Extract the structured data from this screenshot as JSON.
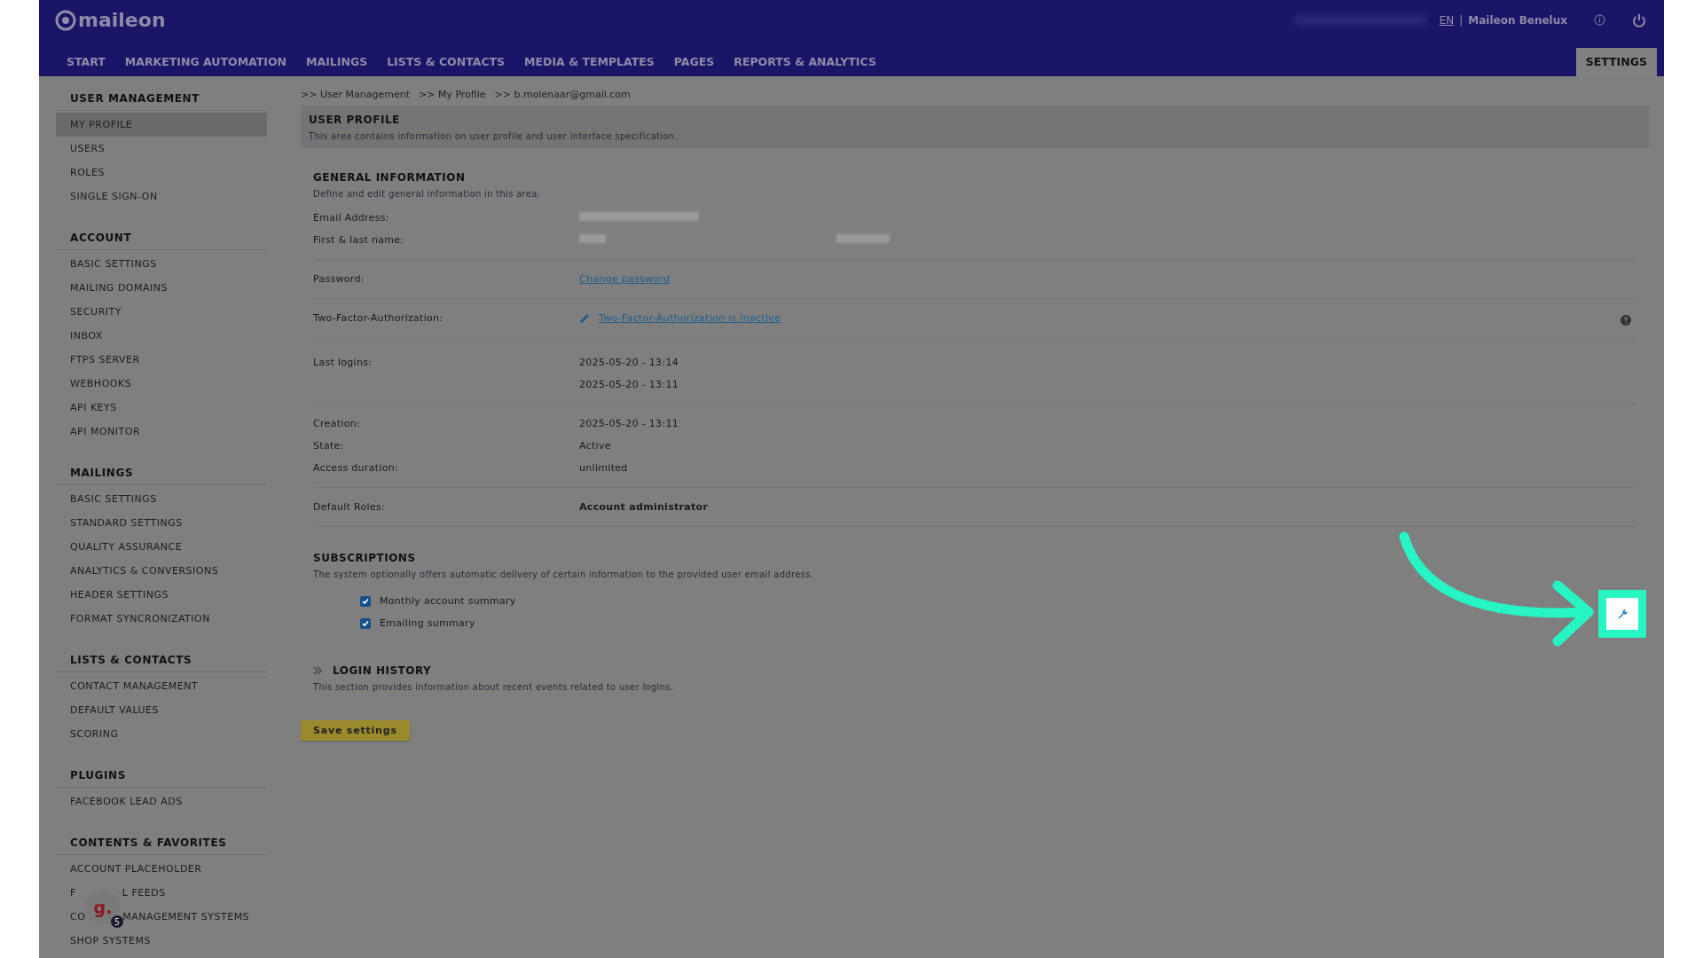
{
  "header": {
    "logo": "maileon",
    "language": "EN",
    "separator": "|",
    "account": "Maileon Benelux",
    "nav": [
      {
        "label": "START",
        "selected": false
      },
      {
        "label": "MARKETING AUTOMATION",
        "selected": false
      },
      {
        "label": "MAILINGS",
        "selected": false
      },
      {
        "label": "LISTS & CONTACTS",
        "selected": false
      },
      {
        "label": "MEDIA & TEMPLATES",
        "selected": false
      },
      {
        "label": "PAGES",
        "selected": false
      },
      {
        "label": "REPORTS & ANALYTICS",
        "selected": false
      },
      {
        "label": "SETTINGS",
        "selected": true
      }
    ]
  },
  "sidebar": [
    {
      "title": "USER MANAGEMENT",
      "items": [
        {
          "label": "MY PROFILE",
          "selected": true
        },
        {
          "label": "USERS",
          "selected": false
        },
        {
          "label": "ROLES",
          "selected": false
        },
        {
          "label": "SINGLE SIGN-ON",
          "selected": false
        }
      ]
    },
    {
      "title": "ACCOUNT",
      "items": [
        {
          "label": "BASIC SETTINGS",
          "selected": false
        },
        {
          "label": "MAILING DOMAINS",
          "selected": false
        },
        {
          "label": "SECURITY",
          "selected": false
        },
        {
          "label": "INBOX",
          "selected": false
        },
        {
          "label": "FTPS SERVER",
          "selected": false
        },
        {
          "label": "WEBHOOKS",
          "selected": false
        },
        {
          "label": "API KEYS",
          "selected": false
        },
        {
          "label": "API MONITOR",
          "selected": false
        }
      ]
    },
    {
      "title": "MAILINGS",
      "items": [
        {
          "label": "BASIC SETTINGS",
          "selected": false
        },
        {
          "label": "STANDARD SETTINGS",
          "selected": false
        },
        {
          "label": "QUALITY ASSURANCE",
          "selected": false
        },
        {
          "label": "ANALYTICS & CONVERSIONS",
          "selected": false
        },
        {
          "label": "HEADER SETTINGS",
          "selected": false
        },
        {
          "label": "FORMAT SYNCRONIZATION",
          "selected": false
        }
      ]
    },
    {
      "title": "LISTS & CONTACTS",
      "items": [
        {
          "label": "CONTACT MANAGEMENT",
          "selected": false
        },
        {
          "label": "DEFAULT VALUES",
          "selected": false
        },
        {
          "label": "SCORING",
          "selected": false
        }
      ]
    },
    {
      "title": "PLUGINS",
      "items": [
        {
          "label": "FACEBOOK LEAD ADS",
          "selected": false
        }
      ]
    },
    {
      "title": "CONTENTS & FAVORITES",
      "items": [
        {
          "label": "ACCOUNT PLACEHOLDER",
          "selected": false
        },
        {
          "label": "F",
          "label_after": "L FEEDS",
          "selected": false
        },
        {
          "label": "CO",
          "label_after": "MANAGEMENT SYSTEMS",
          "selected": false
        },
        {
          "label": "SHOP SYSTEMS",
          "selected": false
        }
      ]
    }
  ],
  "chat_widget": {
    "logo": "g.",
    "count": "5"
  },
  "breadcrumb": [
    ">> User Management",
    ">> My Profile",
    ">> b.molenaar@gmail.com"
  ],
  "page_header": {
    "title": "USER PROFILE",
    "description": "This area contains information on user profile and user interface specification."
  },
  "general": {
    "title": "GENERAL INFORMATION",
    "description": "Define and edit general information in this area.",
    "groups": [
      [
        {
          "label": "Email Address:",
          "kind": "redacted"
        },
        {
          "label": "First & last name:",
          "kind": "redacted_pair"
        }
      ],
      [
        {
          "label": "Password:",
          "kind": "link",
          "values": [
            "Change password"
          ]
        }
      ],
      [
        {
          "label": "Two-Factor-Authorization:",
          "kind": "edit_link",
          "values": [
            "Two-Factor-Authorization is inactive"
          ],
          "help": true
        }
      ],
      [
        {
          "label": "Last logins:",
          "kind": "text",
          "values": [
            "2025-05-20 - 13:14",
            "2025-05-20 - 13:11"
          ]
        }
      ],
      [
        {
          "label": "Creation:",
          "kind": "text",
          "values": [
            "2025-05-20 - 13:11"
          ]
        },
        {
          "label": "State:",
          "kind": "text",
          "values": [
            "Active"
          ]
        },
        {
          "label": "Access duration:",
          "kind": "text",
          "values": [
            "unlimited"
          ]
        }
      ],
      [
        {
          "label": "Default Roles:",
          "kind": "bold",
          "values": [
            "Account administrator"
          ]
        }
      ]
    ]
  },
  "subscriptions": {
    "title": "SUBSCRIPTIONS",
    "description": "The system optionally offers automatic delivery of certain information to the provided user email address.",
    "options": [
      {
        "label": "Monthly account summary",
        "checked": true
      },
      {
        "label": "Emailing summary",
        "checked": true
      }
    ]
  },
  "login_history": {
    "title": "LOGIN HISTORY",
    "expanded": false,
    "description": "This section provides information about recent events related to user logins."
  },
  "save_button": "Save settings",
  "annotation_shown": true
}
